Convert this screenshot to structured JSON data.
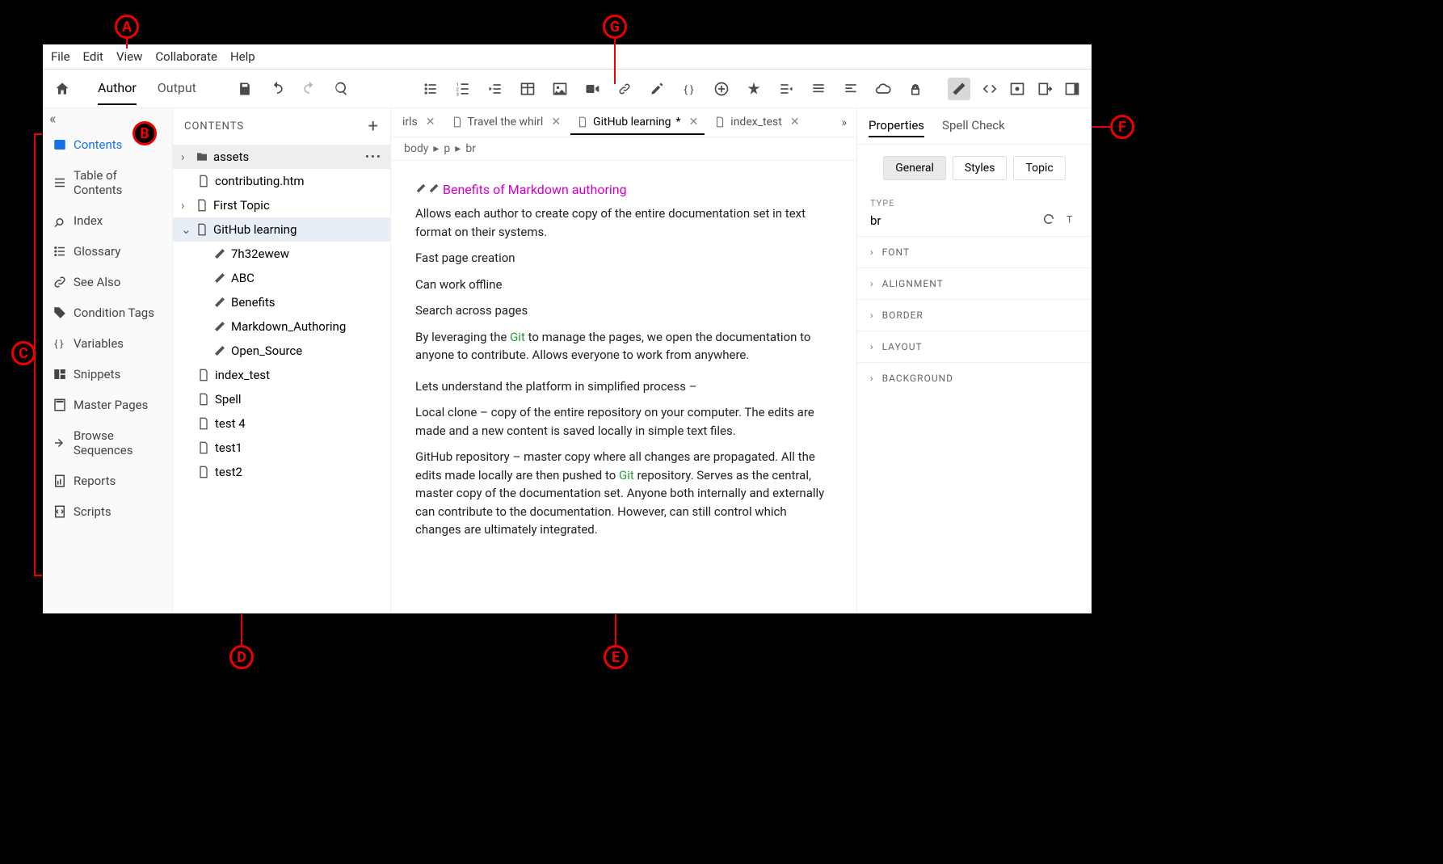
{
  "menubar": [
    "File",
    "Edit",
    "View",
    "Collaborate",
    "Help"
  ],
  "modes": {
    "author": "Author",
    "output": "Output"
  },
  "leftpanel": {
    "items": [
      {
        "id": "contents",
        "label": "Contents",
        "active": true
      },
      {
        "id": "toc",
        "label": "Table of Contents"
      },
      {
        "id": "index",
        "label": "Index"
      },
      {
        "id": "glossary",
        "label": "Glossary"
      },
      {
        "id": "seealso",
        "label": "See Also"
      },
      {
        "id": "condtags",
        "label": "Condition Tags"
      },
      {
        "id": "variables",
        "label": "Variables"
      },
      {
        "id": "snippets",
        "label": "Snippets"
      },
      {
        "id": "master",
        "label": "Master Pages"
      },
      {
        "id": "browse",
        "label": "Browse Sequences"
      },
      {
        "id": "reports",
        "label": "Reports"
      },
      {
        "id": "scripts",
        "label": "Scripts"
      }
    ]
  },
  "contents": {
    "title": "CONTENTS",
    "tree": {
      "assets": "assets",
      "contributing": "contributing.htm",
      "firsttopic": "First Topic",
      "github": "GitHub learning",
      "children": [
        "7h32ewew",
        "ABC",
        "Benefits",
        "Markdown_Authoring",
        "Open_Source"
      ],
      "rest": [
        "index_test",
        "Spell",
        "test 4",
        "test1",
        "test2"
      ]
    }
  },
  "tabs": {
    "t0": {
      "label": "irls"
    },
    "t1": {
      "label": "Travel the whirl"
    },
    "t2": {
      "label": "GitHub learning",
      "dirty": "*",
      "active": true
    },
    "t3": {
      "label": "index_test"
    }
  },
  "crumbs": [
    "body",
    "p",
    "br"
  ],
  "doc": {
    "title": "Benefits of Markdown authoring",
    "p1": "Allows each author to create copy of the entire documentation set in text format on their systems.",
    "p2": "Fast page creation",
    "p3": "Can work offline",
    "p4": "Search across pages",
    "p5a": "By leveraging the ",
    "p5git": "Git",
    "p5b": " to manage the pages, we open the documentation to anyone to contribute. Allows everyone to work from anywhere.",
    "p6": "Lets understand the platform in simplified process –",
    "p7": "Local clone – copy of the entire repository on your computer. The edits are made and a new content is saved locally in simple text files.",
    "p8a": "GitHub repository – master copy where all changes are propagated. All the edits made locally are then pushed to ",
    "p8git": "Git",
    "p8b": " repository. Serves as the central, master copy of the documentation set. Anyone both internally and externally can contribute to the documentation. However, can still control which changes are ultimately integrated."
  },
  "rpanel": {
    "tabs": {
      "properties": "Properties",
      "spell": "Spell Check"
    },
    "subtabs": {
      "general": "General",
      "styles": "Styles",
      "topic": "Topic"
    },
    "type_label": "TYPE",
    "type_val": "br",
    "sections": [
      "FONT",
      "ALIGNMENT",
      "BORDER",
      "LAYOUT",
      "BACKGROUND"
    ]
  },
  "callouts": {
    "A": "A",
    "B": "B",
    "C": "C",
    "D": "D",
    "E": "E",
    "F": "F",
    "G": "G"
  }
}
